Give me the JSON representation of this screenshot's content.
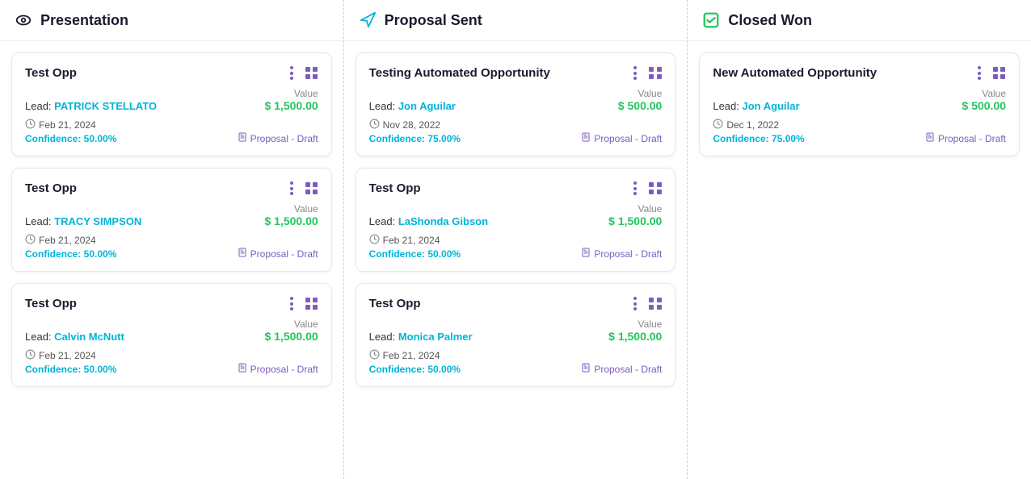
{
  "columns": [
    {
      "id": "presentation",
      "title": "Presentation",
      "icon": "eye",
      "iconColor": "#1a1a2e",
      "cards": [
        {
          "title": "Test Opp",
          "lead": "PATRICK STELLATO",
          "leadColor": "#00b4d8",
          "value": "$ 1,500.00",
          "date": "Feb 21, 2024",
          "confidence": "Confidence: 50.00%",
          "proposal": "Proposal - Draft"
        },
        {
          "title": "Test Opp",
          "lead": "TRACY SIMPSON",
          "leadColor": "#00b4d8",
          "value": "$ 1,500.00",
          "date": "Feb 21, 2024",
          "confidence": "Confidence: 50.00%",
          "proposal": "Proposal - Draft"
        },
        {
          "title": "Test Opp",
          "lead": "Calvin McNutt",
          "leadColor": "#00b4d8",
          "value": "$ 1,500.00",
          "date": "Feb 21, 2024",
          "confidence": "Confidence: 50.00%",
          "proposal": "Proposal - Draft"
        }
      ]
    },
    {
      "id": "proposal-sent",
      "title": "Proposal Sent",
      "icon": "send",
      "iconColor": "#00b4d8",
      "cards": [
        {
          "title": "Testing Automated Opportunity",
          "lead": "Jon Aguilar",
          "leadColor": "#00b4d8",
          "value": "$ 500.00",
          "date": "Nov 28, 2022",
          "confidence": "Confidence: 75.00%",
          "proposal": "Proposal - Draft"
        },
        {
          "title": "Test Opp",
          "lead": "LaShonda Gibson",
          "leadColor": "#00b4d8",
          "value": "$ 1,500.00",
          "date": "Feb 21, 2024",
          "confidence": "Confidence: 50.00%",
          "proposal": "Proposal - Draft"
        },
        {
          "title": "Test Opp",
          "lead": "Monica Palmer",
          "leadColor": "#00b4d8",
          "value": "$ 1,500.00",
          "date": "Feb 21, 2024",
          "confidence": "Confidence: 50.00%",
          "proposal": "Proposal - Draft"
        }
      ]
    },
    {
      "id": "closed-won",
      "title": "Closed Won",
      "icon": "check",
      "iconColor": "#22c55e",
      "cards": [
        {
          "title": "New Automated Opportunity",
          "lead": "Jon Aguilar",
          "leadColor": "#00b4d8",
          "value": "$ 500.00",
          "date": "Dec 1, 2022",
          "confidence": "Confidence: 75.00%",
          "proposal": "Proposal - Draft"
        }
      ]
    }
  ],
  "labels": {
    "lead_prefix": "Lead:",
    "value_label": "Value"
  }
}
